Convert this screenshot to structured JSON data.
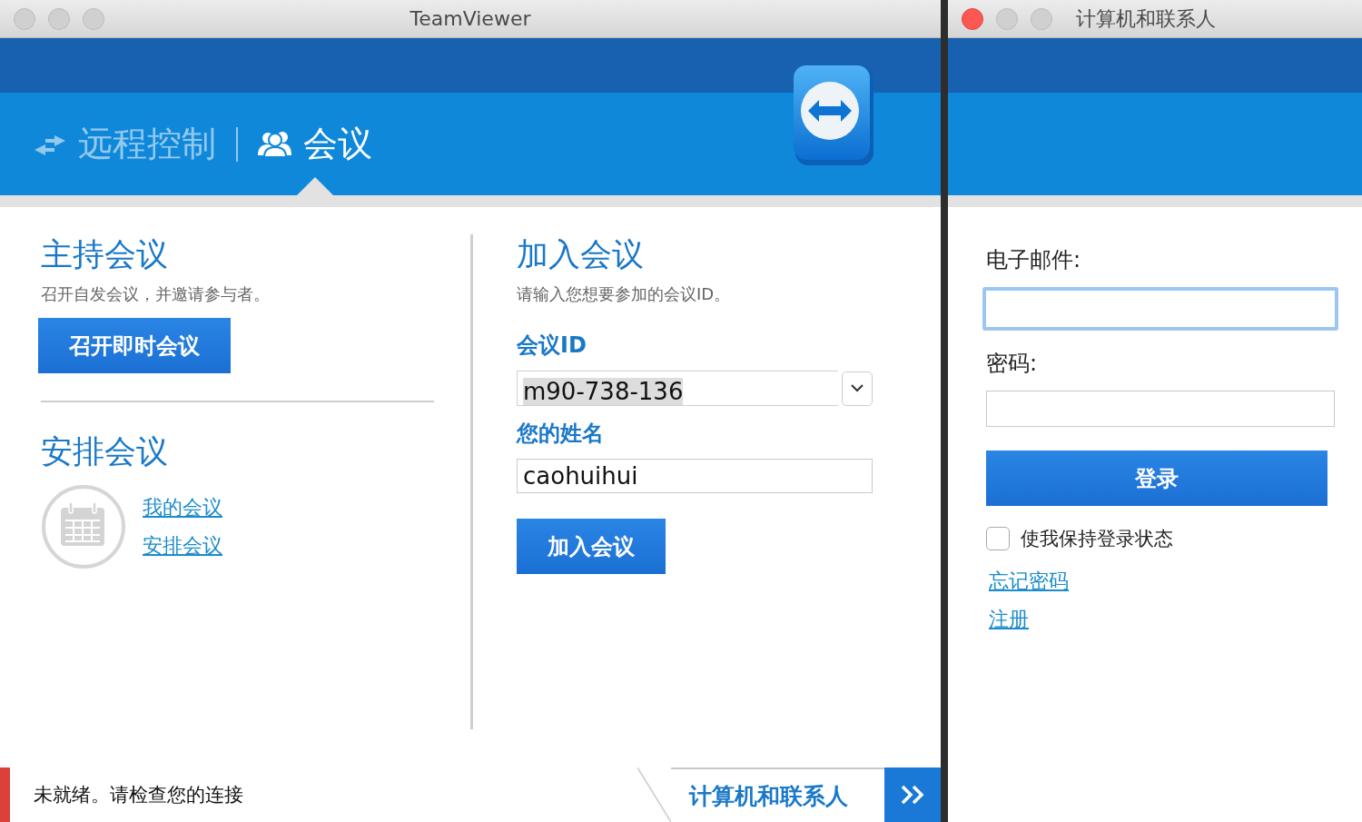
{
  "main_window": {
    "title": "TeamViewer",
    "active": false,
    "tabs": [
      {
        "label": "远程控制",
        "selected": false,
        "kind": "remote"
      },
      {
        "label": "会议",
        "selected": true,
        "kind": "meeting"
      }
    ],
    "host": {
      "heading": "主持会议",
      "description": "召开自发会议，并邀请参与者。",
      "button": "召开即时会议"
    },
    "schedule": {
      "heading": "安排会议",
      "links": [
        "我的会议",
        "安排会议"
      ]
    },
    "join": {
      "heading": "加入会议",
      "description": "请输入您想要参加的会议ID。",
      "id_label": "会议ID",
      "id_value": "m90-738-136",
      "name_label": "您的姓名",
      "name_value": "caohuihui",
      "button": "加入会议"
    },
    "status_bar": {
      "text": "未就绪。请检查您的连接",
      "ready": false,
      "panel_button": "计算机和联系人"
    }
  },
  "contacts_window": {
    "title": "计算机和联系人",
    "active": true,
    "email_label": "电子邮件:",
    "email_focused": true,
    "password_label": "密码:",
    "login_button": "登录",
    "remember": {
      "label": "使我保持登录状态",
      "checked": false
    },
    "links": [
      "忘记密码",
      "注册"
    ]
  }
}
